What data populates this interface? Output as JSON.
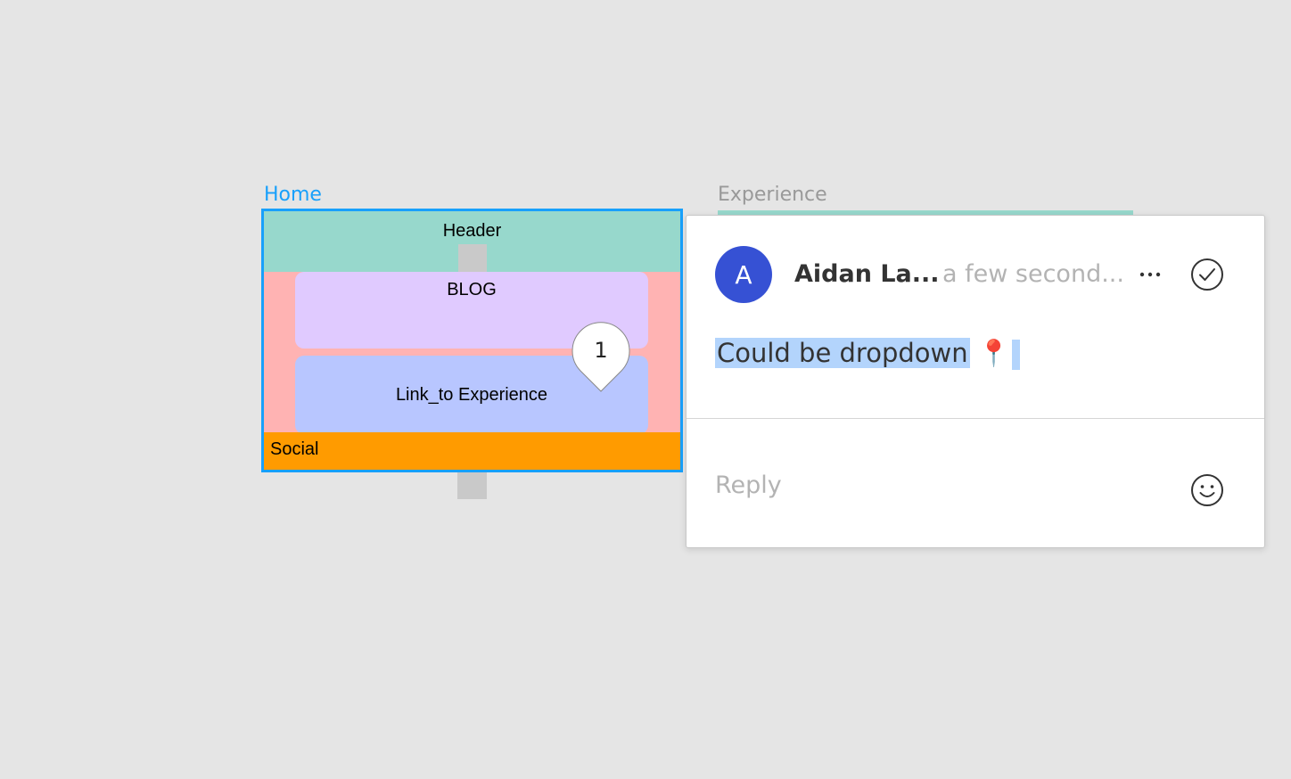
{
  "canvas": {
    "home_frame_label": "Home",
    "experience_frame_label": "Experience",
    "home_frame": {
      "header": "Header",
      "blog": "BLOG",
      "link": "Link_to Experience",
      "social": "Social"
    },
    "comment_pin_number": "1"
  },
  "comment": {
    "avatar_initial": "A",
    "author": "Aidan La...",
    "timestamp": "a few second...",
    "more_icon": "more-icon",
    "resolve_icon": "check-circle-icon",
    "text": "Could be dropdown",
    "emoji": "📍",
    "reply_placeholder": "Reply",
    "emoji_button_icon": "smiley-icon"
  },
  "colors": {
    "selection": "#18a0fb",
    "avatar": "#3651d4",
    "header": "#97d8cc",
    "blog": "#e0caff",
    "link": "#b8c6ff",
    "social": "#ff9b00",
    "frame_bg": "#ffb3b3"
  }
}
